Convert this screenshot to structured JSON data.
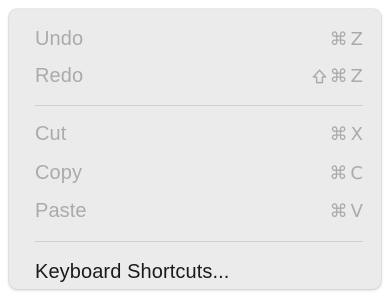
{
  "menu": {
    "items": [
      {
        "label": "Undo",
        "shortcut_key": "Z",
        "modifiers": [
          "command"
        ],
        "enabled": false
      },
      {
        "label": "Redo",
        "shortcut_key": "Z",
        "modifiers": [
          "shift",
          "command"
        ],
        "enabled": false
      },
      {
        "label": "Cut",
        "shortcut_key": "X",
        "modifiers": [
          "command"
        ],
        "enabled": false
      },
      {
        "label": "Copy",
        "shortcut_key": "C",
        "modifiers": [
          "command"
        ],
        "enabled": false
      },
      {
        "label": "Paste",
        "shortcut_key": "V",
        "modifiers": [
          "command"
        ],
        "enabled": false
      },
      {
        "label": "Keyboard Shortcuts...",
        "enabled": true
      }
    ],
    "symbols": {
      "command": "⌘"
    }
  },
  "colors": {
    "menu_background": "#ebebeb",
    "disabled_text": "#ababab",
    "enabled_text": "#1a1a1a",
    "separator": "#d0d0d0"
  }
}
